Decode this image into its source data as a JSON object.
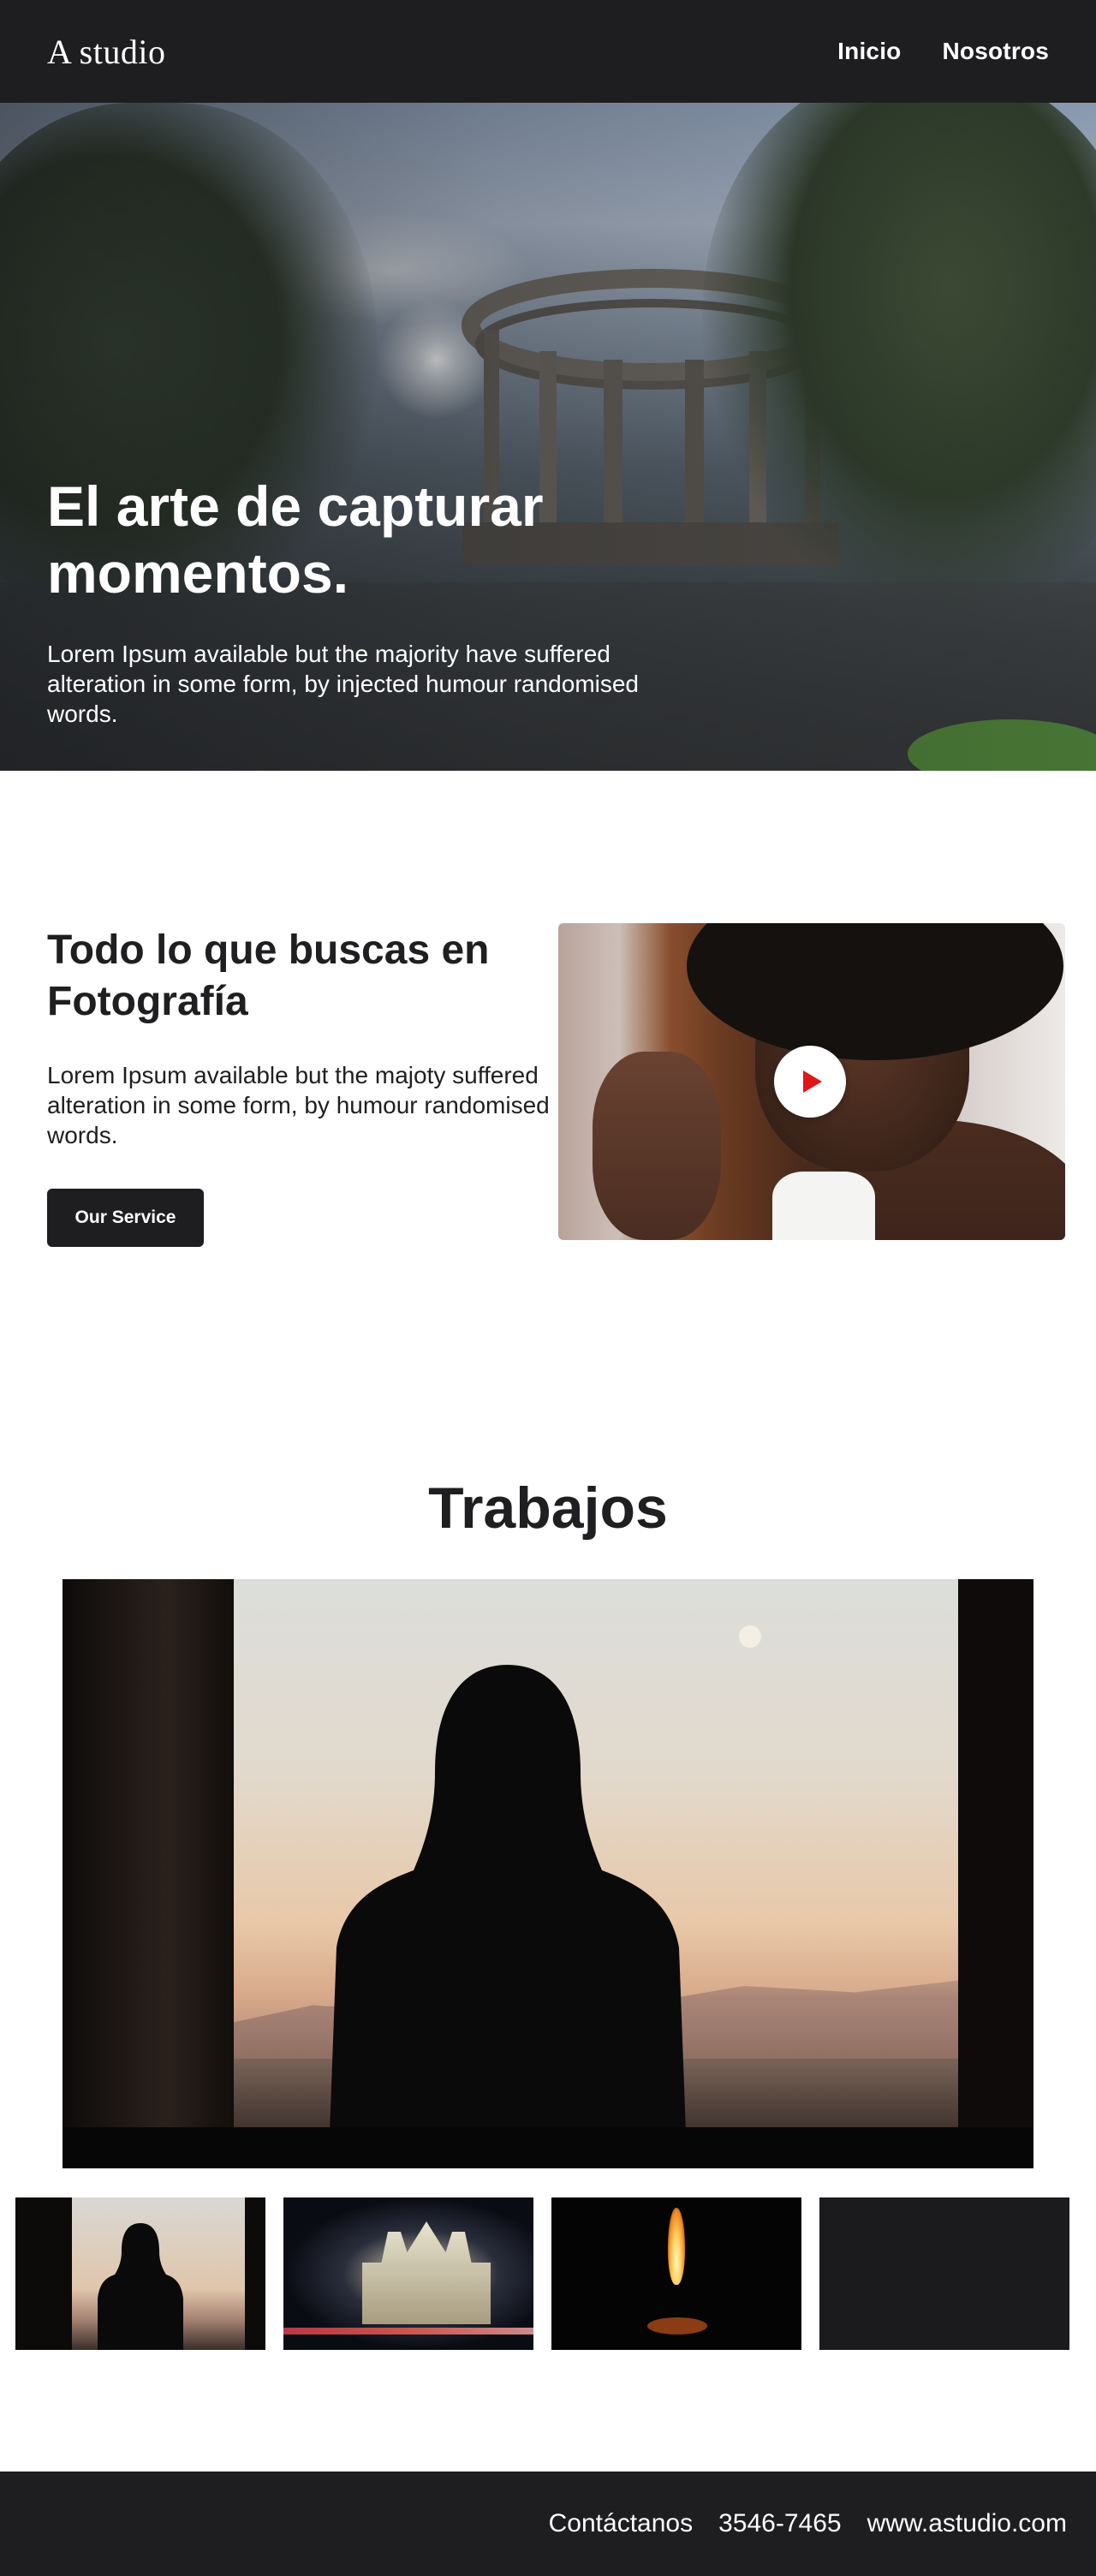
{
  "header": {
    "logo": "A studio",
    "nav": [
      {
        "label": "Inicio"
      },
      {
        "label": "Nosotros"
      }
    ]
  },
  "hero": {
    "title": "El arte de capturar momentos.",
    "text": "Lorem Ipsum available but the majority have suffered alteration in some form, by injected humour randomised words."
  },
  "intro": {
    "title": "Todo lo que buscas en Fotografía",
    "text": "Lorem Ipsum available but the majoty suffered alteration in some form, by humour randomised words.",
    "button_label": "Our Service",
    "video": {
      "play_icon": "play-icon",
      "accent_color": "#e0161b"
    }
  },
  "works": {
    "title": "Trabajos",
    "thumbnails": [
      {
        "id": "silhouette-window"
      },
      {
        "id": "church-night"
      },
      {
        "id": "candle-flame"
      },
      {
        "id": "empty"
      }
    ]
  },
  "footer": {
    "contact_label": "Contáctanos",
    "phone": "3546-7465",
    "website": "www.astudio.com"
  },
  "colors": {
    "dark": "#1e1e20",
    "text": "#1f1f21",
    "background": "#ffffff"
  }
}
